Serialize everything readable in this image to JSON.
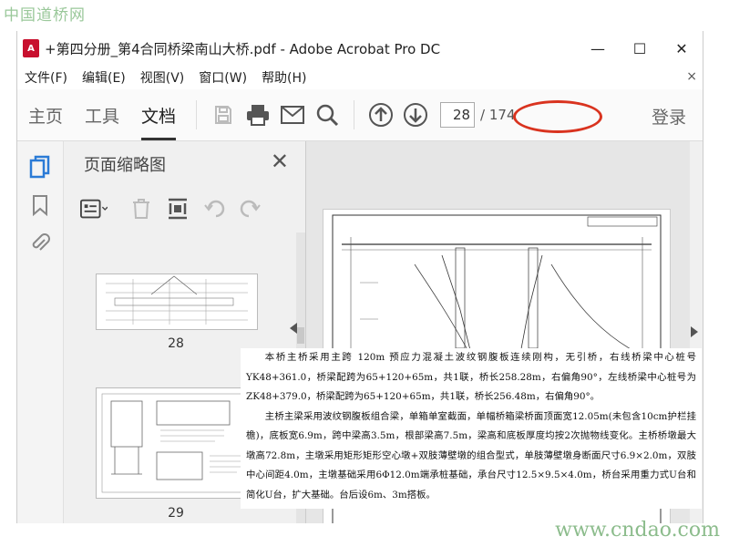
{
  "watermark": {
    "top": "中国道桥网",
    "bottom": "www.cndao.com"
  },
  "window": {
    "title": "+第四分册_第4合同桥梁南山大桥.pdf - Adobe Acrobat Pro DC",
    "controls": {
      "minimize": "—",
      "maximize": "☐",
      "close": "✕"
    }
  },
  "menu": {
    "items": [
      "文件(F)",
      "编辑(E)",
      "视图(V)",
      "窗口(W)",
      "帮助(H)"
    ],
    "close": "×"
  },
  "toolbar": {
    "tabs": [
      "主页",
      "工具",
      "文档"
    ],
    "active_tab": "文档",
    "page_current": "28",
    "page_total": "/ 174",
    "signin": "登录",
    "accent_color": "#d9331f"
  },
  "thumbnails_panel": {
    "title": "页面缩略图",
    "close": "✕",
    "pages": [
      {
        "label": "28"
      },
      {
        "label": "29"
      }
    ]
  },
  "document_text": {
    "paragraph1": "本桥主桥采用主跨 120m 预应力混凝土波纹钢腹板连续刚构，无引桥，右线桥梁中心桩号YK48+361.0，桥梁配跨为65+120+65m，共1联，桥长258.28m，右偏角90°，左线桥梁中心桩号为ZK48+379.0，桥梁配跨为65+120+65m，共1联，桥长256.48m，右偏角90°。",
    "paragraph2": "主桥主梁采用波纹钢腹板组合梁，单箱单室截面，单幅桥箱梁桥面顶面宽12.05m(未包含10cm护栏挂檐)，底板宽6.9m，跨中梁高3.5m，根部梁高7.5m，梁高和底板厚度均按2次抛物线变化。主桥桥墩最大墩高72.8m，主墩采用矩形矩形空心墩+双肢薄壁墩的组合型式，单肢薄壁墩身断面尺寸6.9×2.0m，双肢中心间距4.0m，主墩基础采用6Φ12.0m端承桩基础，承台尺寸12.5×9.5×4.0m，桥台采用重力式U台和简化U台，扩大基础。台后设6m、3m搭板。"
  }
}
